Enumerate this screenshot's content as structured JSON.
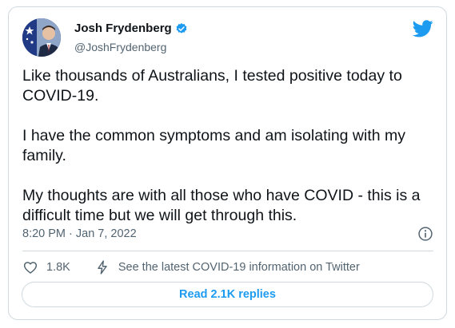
{
  "author": {
    "name": "Josh Frydenberg",
    "handle": "@JoshFrydenberg",
    "verified": true
  },
  "tweet": {
    "paragraphs": [
      "Like thousands of Australians, I tested positive today to COVID-19.",
      "I have the common symptoms and am isolating with my family.",
      "My thoughts are with all those who have COVID - this is a difficult time but we will get through this."
    ],
    "timestamp": "8:20 PM · Jan 7, 2022"
  },
  "actions": {
    "like_count": "1.8K",
    "share_label": "See the latest COVID-19 information on Twitter"
  },
  "replies_button": "Read 2.1K replies",
  "colors": {
    "accent": "#1d9bf0",
    "text": "#0f1419",
    "secondary": "#536471",
    "border": "#cfd9de"
  },
  "icons": [
    "avatar",
    "verified-badge-icon",
    "twitter-bird-icon",
    "info-icon",
    "heart-icon",
    "lightning-icon"
  ]
}
